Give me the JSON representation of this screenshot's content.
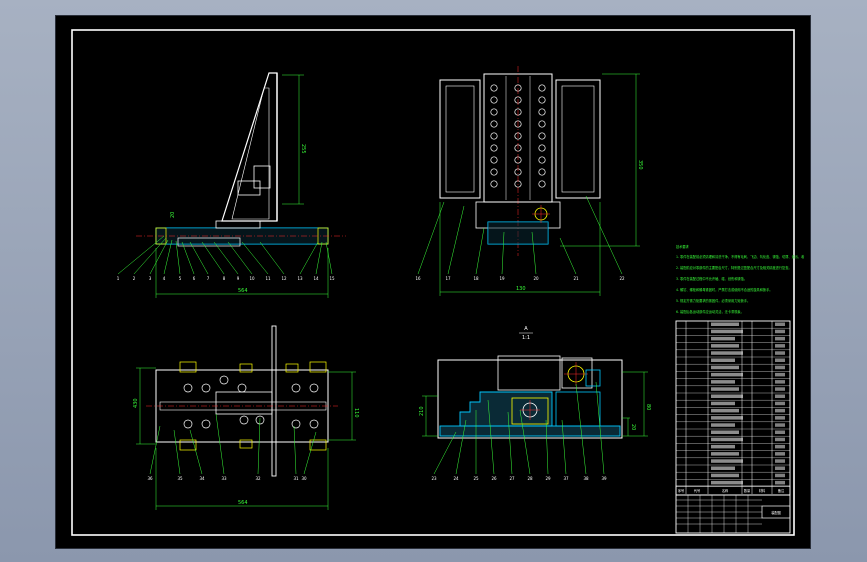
{
  "window": {
    "title": ""
  },
  "colors": {
    "background": "#000000",
    "outline": "#ffffff",
    "dimension": "#39ff39",
    "section": "#00c8ff",
    "center_line": "#ff2a2a",
    "highlight": "#ffff00",
    "desktop": "#8f9bb0"
  },
  "views": {
    "front": {
      "dim_height": "255",
      "dim_width": "564",
      "dim_small": "20",
      "balloons": [
        "1",
        "2",
        "3",
        "4",
        "5",
        "6",
        "7",
        "8",
        "9",
        "10",
        "11",
        "12",
        "13",
        "14",
        "15"
      ]
    },
    "side": {
      "dim_height": "350",
      "dim_width": "130",
      "balloons": [
        "16",
        "17",
        "18",
        "19",
        "20",
        "21",
        "22"
      ]
    },
    "top": {
      "dim_left": "430",
      "dim_right": "110",
      "dim_width": "564",
      "balloons": [
        "36",
        "35",
        "34",
        "33",
        "32",
        "31",
        "30"
      ]
    },
    "section": {
      "title_letter": "A",
      "title_scale": "1:1",
      "dim_left": "210",
      "dim_right": "80",
      "dim_right2": "20",
      "balloons": [
        "23",
        "24",
        "25",
        "26",
        "27",
        "28",
        "29",
        "37",
        "38",
        "39"
      ]
    }
  },
  "notes": {
    "title": "技术要求",
    "lines": [
      "1. 零件在装配前必须清理和清洗干净，不得有毛刺、飞边、氧化皮、锈蚀、切屑、油污、着色剂和灰尘等。",
      "2. 装配前应对零部件的主要配合尺寸，特别是过盈配合尺寸及相关精度进行复查。",
      "3. 零件在装配过程中不允许磕、碰、划伤和锈蚀。",
      "4. 螺钉、螺栓和螺母紧固时，严禁打击或使用不合适的旋具和扳手。",
      "5. 规定拧紧力矩要求的紧固件，必须采用力矩扳手。",
      "6. 装配后各运动部件应运动灵活，无卡滞现象。"
    ]
  },
  "title_block": {
    "drawing_name": "装配图",
    "header": [
      "序号",
      "代号",
      "名称",
      "数量",
      "材料",
      "备注"
    ]
  }
}
